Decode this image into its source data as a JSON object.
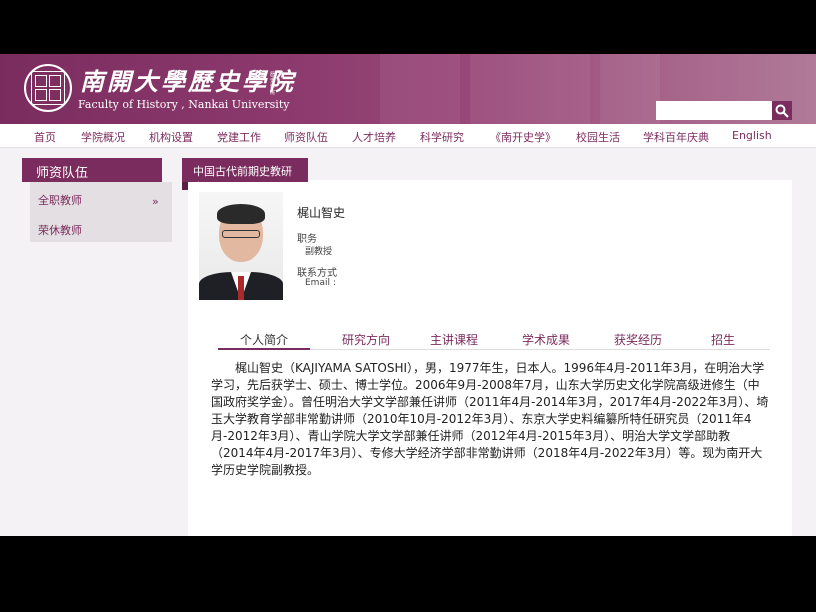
{
  "header": {
    "logo_cn": "南開大學歷史學院",
    "logo_en": "Faculty of History , Nankai University",
    "side_text": "歷史學院",
    "search": {
      "value": "",
      "placeholder": ""
    }
  },
  "nav": {
    "items": [
      "首页",
      "学院概况",
      "机构设置",
      "党建工作",
      "师资队伍",
      "人才培养",
      "科学研究",
      "《南开史学》",
      "校园生活",
      "学科百年庆典",
      "English"
    ]
  },
  "sidebar": {
    "title": "师资队伍",
    "items": [
      "全职教师",
      "荣休教师"
    ]
  },
  "breadcrumb": "中国古代前期史教研室",
  "profile": {
    "name": "梶山智史",
    "position_label": "职务",
    "position_value": "副教授",
    "contact_label": "联系方式",
    "email_label": "Email :"
  },
  "tabs": [
    "个人简介",
    "研究方向",
    "主讲课程",
    "学术成果",
    "获奖经历",
    "招生"
  ],
  "active_tab": "个人简介",
  "bio": "梶山智史（KAJIYAMA SATOSHI），男，1977年生，日本人。1996年4月-2011年3月，在明治大学学习，先后获学士、硕士、博士学位。2006年9月-2008年7月，山东大学历史文化学院高级进修生（中国政府奖学金）。曾任明治大学文学部兼任讲师（2011年4月-2014年3月，2017年4月-2022年3月）、埼玉大学教育学部非常勤讲师（2010年10月-2012年3月）、东京大学史料编纂所特任研究员（2011年4月-2012年3月）、青山学院大学文学部兼任讲师（2012年4月-2015年3月）、明治大学文学部助教（2014年4月-2017年3月）、专修大学经济学部非常勤讲师（2018年4月-2022年3月）等。现为南开大学历史学院副教授。",
  "colors": {
    "brand": "#7b2c5e",
    "panel": "#e3dfe2",
    "page_bg": "#f4f2f4"
  },
  "icons": {
    "search": "search-icon",
    "seal": "university-seal-icon",
    "sidebar_arrow": "double-chevron-right-icon"
  }
}
